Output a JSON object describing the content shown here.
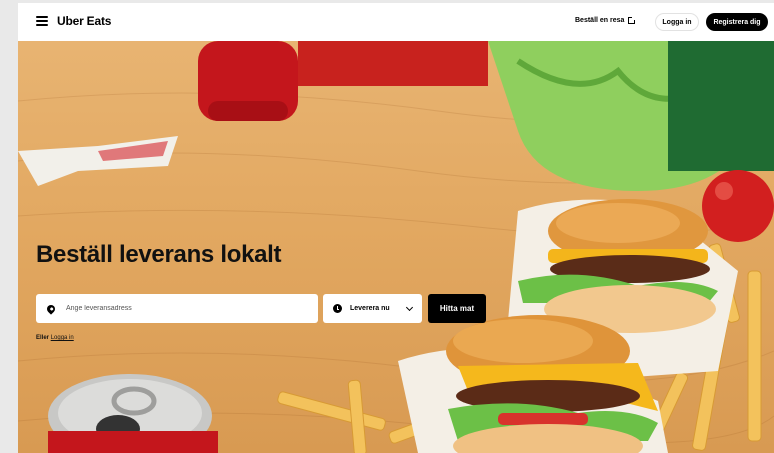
{
  "header": {
    "logo": "Uber Eats",
    "ride_link": "Beställ en resa",
    "login": "Logga in",
    "signup": "Registrera dig"
  },
  "hero": {
    "headline": "Beställ leverans lokalt",
    "address_placeholder": "Ange leveransadress",
    "delivery_time": "Leverera nu",
    "find_button": "Hitta mat",
    "or_prefix": "Eller",
    "or_login_link": "Logga in"
  },
  "icons": [
    "menu-icon",
    "external-link-icon",
    "location-pin-icon",
    "clock-icon",
    "chevron-down-icon"
  ],
  "colors": {
    "brand": "#000000",
    "background": "#ffffff",
    "table": "#e2a861"
  }
}
